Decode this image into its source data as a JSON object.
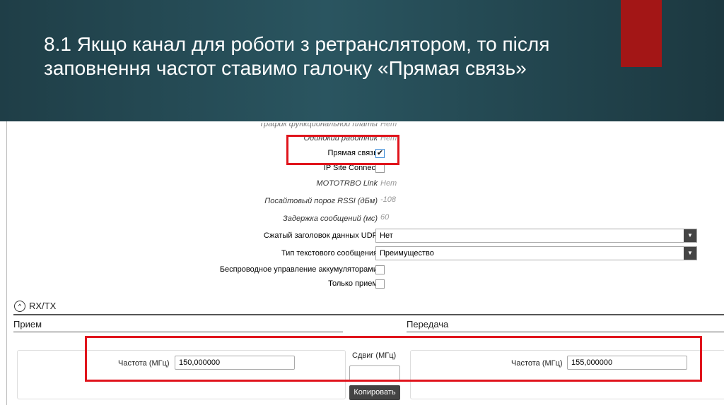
{
  "slide": {
    "title": "8.1 Якщо канал для роботи з ретранслятором, то після заповнення частот ставимо галочку «Прямая связь»"
  },
  "form": {
    "rows": [
      {
        "label": "Трафик функциональной платы",
        "value": "Нет"
      },
      {
        "label": "Одинокий работник",
        "value": "Нет"
      },
      {
        "label": "Прямая связь",
        "checked": true
      },
      {
        "label": "IP Site Connect",
        "checked": false
      },
      {
        "label": "MOTOTRBO Link",
        "value": "Нет"
      },
      {
        "label": "Посайтовый порог RSSI (дБм)",
        "value": "-108"
      },
      {
        "label": "Задержка сообщений (мс)",
        "value": "60"
      },
      {
        "label": "Сжатый заголовок данных UDP",
        "value": "Нет"
      },
      {
        "label": "Тип текстового сообщения",
        "value": "Преимущество"
      },
      {
        "label": "Беспроводное управление аккумуляторами",
        "checked": false
      },
      {
        "label": "Только прием",
        "checked": false
      }
    ]
  },
  "rxtx": {
    "title": "RX/TX",
    "rx_label": "Прием",
    "tx_label": "Передача",
    "freq_label": "Частота (МГц)",
    "rx_freq": "150,000000",
    "tx_freq": "155,000000",
    "shift_label": "Сдвиг (МГц)",
    "shift_value": "",
    "copy_label": "Копировать"
  },
  "colors": {
    "highlight": "#e0141c",
    "accent": "#a31616"
  }
}
